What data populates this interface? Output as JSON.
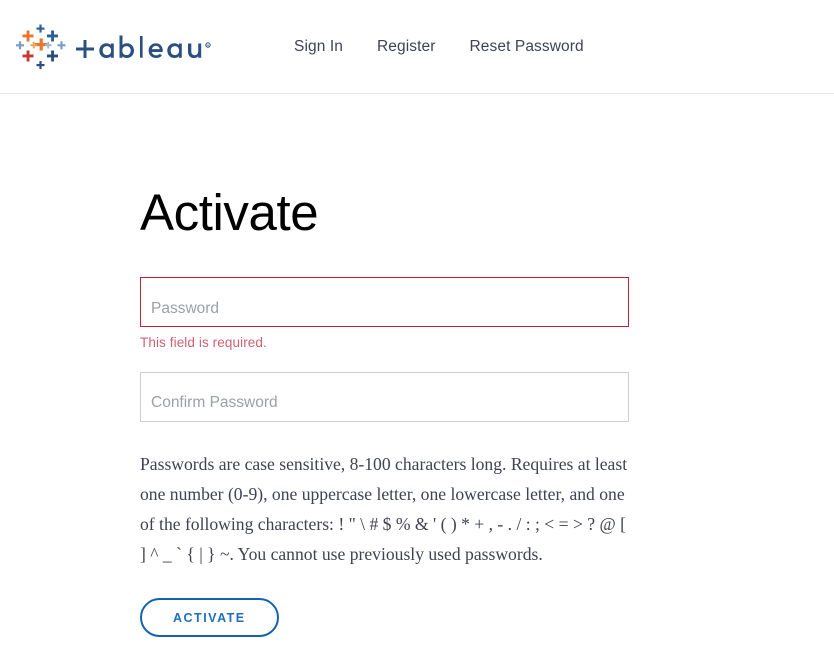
{
  "header": {
    "logo": {
      "icon_name": "tableau-logo",
      "wordmark": "+ableau",
      "trademark": "®",
      "colors": {
        "orange": "#e8762c",
        "blue": "#2e5f9a",
        "red": "#c53a32",
        "light_blue": "#7b9fc4",
        "navy": "#2b4f81"
      }
    },
    "nav": [
      {
        "label": "Sign In",
        "name": "nav-link-sign-in"
      },
      {
        "label": "Register",
        "name": "nav-link-register"
      },
      {
        "label": "Reset Password",
        "name": "nav-link-reset-password"
      }
    ]
  },
  "main": {
    "title": "Activate",
    "password_field": {
      "placeholder": "Password",
      "value": "",
      "error": "This field is required.",
      "error_color": "#cf6074",
      "border_color": "#c2203a"
    },
    "confirm_password_field": {
      "placeholder": "Confirm Password",
      "value": "",
      "border_color": "#cfcfcf"
    },
    "help_text": "Passwords are case sensitive, 8-100 characters long. Requires at least one number (0-9), one uppercase letter, one lowercase letter, and one of the following characters: ! \" \\ # $ % & ' ( ) * + , - . / : ; < = > ? @ [ ] ^ _ ` { | } ~. You cannot use previously used passwords.",
    "submit_button": {
      "label": "ACTIVATE",
      "text_color": "#1f6fbf",
      "border_color": "#1463ad"
    }
  }
}
